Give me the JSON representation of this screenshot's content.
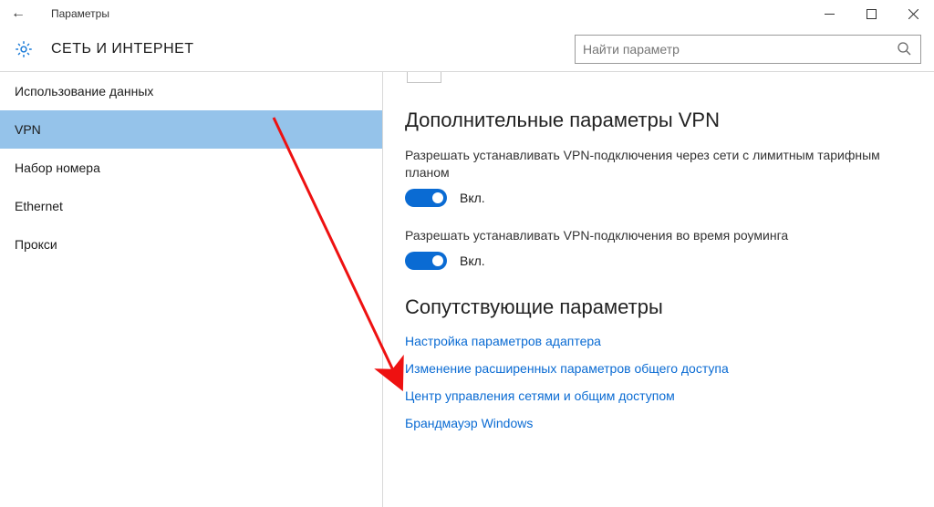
{
  "window": {
    "title": "Параметры"
  },
  "header": {
    "category": "СЕТЬ И ИНТЕРНЕТ",
    "search_placeholder": "Найти параметр"
  },
  "sidebar": {
    "items": [
      {
        "label": "Использование данных",
        "selected": false
      },
      {
        "label": "VPN",
        "selected": true
      },
      {
        "label": "Набор номера",
        "selected": false
      },
      {
        "label": "Ethernet",
        "selected": false
      },
      {
        "label": "Прокси",
        "selected": false
      }
    ]
  },
  "content": {
    "advanced_section_title": "Дополнительные параметры VPN",
    "setting1_desc": "Разрешать устанавливать VPN-подключения через сети с лимитным тарифным планом",
    "setting1_state": "Вкл.",
    "setting2_desc": "Разрешать устанавливать VPN-подключения во время роуминга",
    "setting2_state": "Вкл.",
    "related_section_title": "Сопутствующие параметры",
    "related_links": [
      "Настройка параметров адаптера",
      "Изменение расширенных параметров общего доступа",
      "Центр управления сетями и общим доступом",
      "Брандмауэр Windows"
    ]
  }
}
